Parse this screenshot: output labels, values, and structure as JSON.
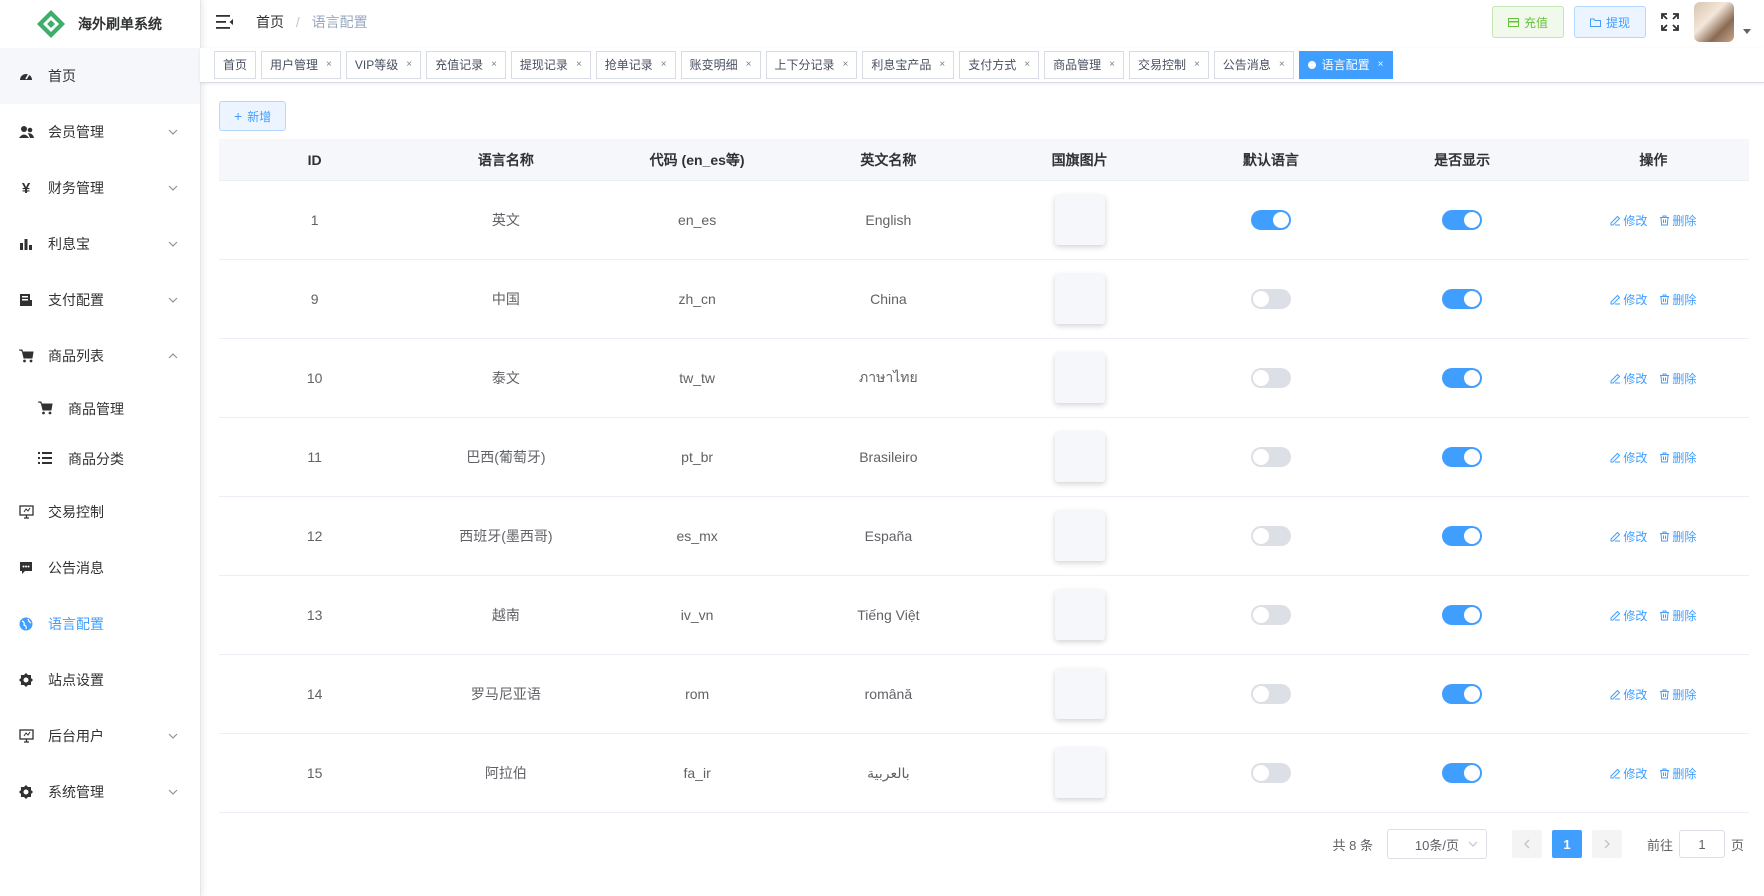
{
  "app": {
    "title": "海外刷单系统"
  },
  "colors": {
    "primary": "#409eff",
    "success": "#67c23a",
    "switch_off": "#dcdfe6"
  },
  "sidebar": {
    "items": [
      {
        "label": "首页",
        "icon": "dashboard-icon"
      },
      {
        "label": "会员管理",
        "icon": "users-icon"
      },
      {
        "label": "财务管理",
        "icon": "yen-icon"
      },
      {
        "label": "利息宝",
        "icon": "bar-chart-icon"
      },
      {
        "label": "支付配置",
        "icon": "payment-icon"
      },
      {
        "label": "商品列表",
        "icon": "cart-icon"
      },
      {
        "label": "商品管理",
        "icon": "cart-icon"
      },
      {
        "label": "商品分类",
        "icon": "list-icon"
      },
      {
        "label": "交易控制",
        "icon": "monitor-icon"
      },
      {
        "label": "公告消息",
        "icon": "message-icon"
      },
      {
        "label": "语言配置",
        "icon": "globe-icon"
      },
      {
        "label": "站点设置",
        "icon": "gear-icon"
      },
      {
        "label": "后台用户",
        "icon": "monitor-icon"
      },
      {
        "label": "系统管理",
        "icon": "gear-icon"
      }
    ]
  },
  "header": {
    "breadcrumb_home": "首页",
    "breadcrumb_sep": "/",
    "breadcrumb_current": "语言配置",
    "recharge_label": "充值",
    "withdraw_label": "提现"
  },
  "tags": [
    {
      "label": "首页"
    },
    {
      "label": "用户管理"
    },
    {
      "label": "VIP等级"
    },
    {
      "label": "充值记录"
    },
    {
      "label": "提现记录"
    },
    {
      "label": "抢单记录"
    },
    {
      "label": "账变明细"
    },
    {
      "label": "上下分记录"
    },
    {
      "label": "利息宝产品"
    },
    {
      "label": "支付方式"
    },
    {
      "label": "商品管理"
    },
    {
      "label": "交易控制"
    },
    {
      "label": "公告消息"
    },
    {
      "label": "语言配置"
    }
  ],
  "tag_close": "×",
  "main": {
    "add_label": "新增",
    "add_plus": "+",
    "columns": [
      "ID",
      "语言名称",
      "代码 (en_es等)",
      "英文名称",
      "国旗图片",
      "默认语言",
      "是否显示",
      "操作"
    ],
    "edit_label": "修改",
    "delete_label": "删除",
    "rows": [
      {
        "id": "1",
        "name": "英文",
        "code": "en_es",
        "en_name": "English",
        "default": true,
        "show": true
      },
      {
        "id": "9",
        "name": "中国",
        "code": "zh_cn",
        "en_name": "China",
        "default": false,
        "show": true
      },
      {
        "id": "10",
        "name": "泰文",
        "code": "tw_tw",
        "en_name": "ภาษาไทย",
        "default": false,
        "show": true
      },
      {
        "id": "11",
        "name": "巴西(葡萄牙)",
        "code": "pt_br",
        "en_name": "Brasileiro",
        "default": false,
        "show": true
      },
      {
        "id": "12",
        "name": "西班牙(墨西哥)",
        "code": "es_mx",
        "en_name": "España",
        "default": false,
        "show": true
      },
      {
        "id": "13",
        "name": "越南",
        "code": "iv_vn",
        "en_name": "Tiếng Việt",
        "default": false,
        "show": true
      },
      {
        "id": "14",
        "name": "罗马尼亚语",
        "code": "rom",
        "en_name": "română",
        "default": false,
        "show": true
      },
      {
        "id": "15",
        "name": "阿拉伯",
        "code": "fa_ir",
        "en_name": "بالعربية",
        "default": false,
        "show": true
      }
    ]
  },
  "pagination": {
    "total_label": "共 8 条",
    "page_size": "10条/页",
    "current_page": "1",
    "goto_prefix": "前往",
    "goto_value": "1",
    "goto_suffix": "页"
  }
}
